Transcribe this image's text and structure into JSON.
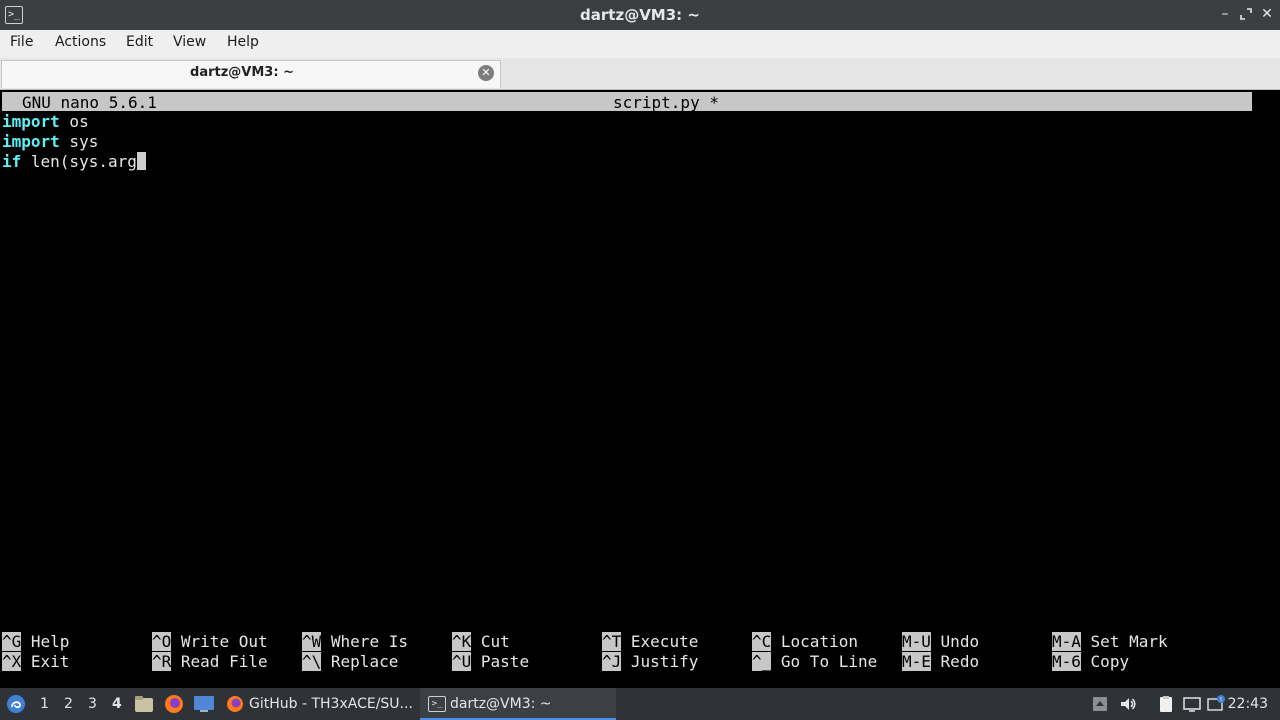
{
  "window": {
    "title": "dartz@VM3: ~",
    "app_icon": "terminal-icon",
    "controls": [
      "minimize",
      "maximize",
      "close"
    ]
  },
  "menu": {
    "items": [
      "File",
      "Actions",
      "Edit",
      "View",
      "Help"
    ]
  },
  "tabs": [
    {
      "label": "dartz@VM3: ~",
      "active": true
    }
  ],
  "nano": {
    "version": "GNU nano 5.6.1",
    "filename": "script.py *",
    "lines": [
      {
        "keyword": "import",
        "rest": " os"
      },
      {
        "keyword": "import",
        "rest": " sys"
      },
      {
        "keyword": "if",
        "rest": " len(sys.arg"
      }
    ],
    "shortcuts_row1": [
      {
        "key": "^G",
        "label": "Help"
      },
      {
        "key": "^O",
        "label": "Write Out"
      },
      {
        "key": "^W",
        "label": "Where Is"
      },
      {
        "key": "^K",
        "label": "Cut"
      },
      {
        "key": "^T",
        "label": "Execute"
      },
      {
        "key": "^C",
        "label": "Location"
      },
      {
        "key": "M-U",
        "label": "Undo"
      },
      {
        "key": "M-A",
        "label": "Set Mark"
      }
    ],
    "shortcuts_row2": [
      {
        "key": "^X",
        "label": "Exit"
      },
      {
        "key": "^R",
        "label": "Read File"
      },
      {
        "key": "^\\",
        "label": "Replace"
      },
      {
        "key": "^U",
        "label": "Paste"
      },
      {
        "key": "^J",
        "label": "Justify"
      },
      {
        "key": "^_",
        "label": "Go To Line"
      },
      {
        "key": "M-E",
        "label": "Redo"
      },
      {
        "key": "M-6",
        "label": "Copy"
      }
    ]
  },
  "taskbar": {
    "workspaces": [
      "1",
      "2",
      "3",
      "4"
    ],
    "active_workspace": "4",
    "tasks": [
      {
        "label": "GitHub - TH3xACE/SU...",
        "icon": "firefox-icon"
      },
      {
        "label": "dartz@VM3: ~",
        "icon": "terminal-icon",
        "active": true
      }
    ],
    "clock": "22:43"
  },
  "colors": {
    "keyword": "#5ff0f5",
    "nano_bar": "#c7c7c7",
    "taskbar": "#2f3236",
    "accent": "#4b8ee8"
  }
}
